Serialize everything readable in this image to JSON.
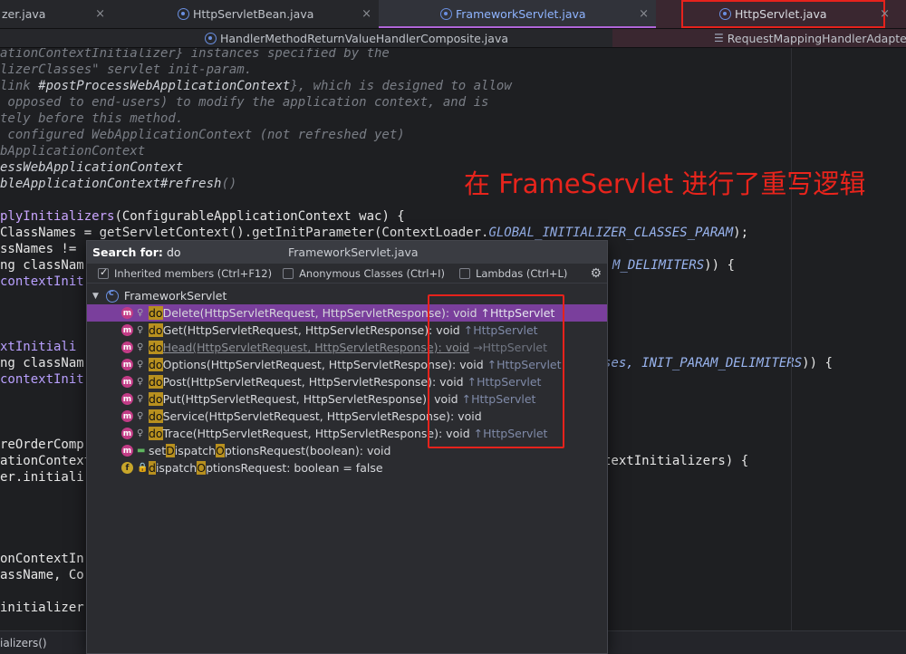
{
  "tabs_row1": [
    {
      "label": "zer.java",
      "close": "×"
    },
    {
      "label": "HttpServletBean.java",
      "close": "×"
    },
    {
      "label": "FrameworkServlet.java",
      "close": "×"
    },
    {
      "label": "HttpServlet.java",
      "close": "×"
    }
  ],
  "tabs_row2": [
    {
      "label": "HandlerMethodReturnValueHandlerComposite.java"
    },
    {
      "label": "RequestMappingHandlerAdapte"
    }
  ],
  "code": {
    "l1": "ationContextInitializer} instances specified by the",
    "l2": "lizerClasses\" servlet init-param.",
    "l3a": "link ",
    "l3b": "#postProcessWebApplicationContext",
    "l3c": "}, which is designed to allow",
    "l4": " opposed to end-users) to modify the application context, and is",
    "l5": "tely before this method.",
    "l6": " configured WebApplicationContext (not refreshed yet)",
    "l7": "bApplicationContext",
    "l8": "essWebApplicationContext",
    "l9a": "bleApplicationContext",
    "l9b": "#refresh",
    "l9c": "()",
    "l10a": "plyInitializers",
    "l10b": "(ConfigurableApplicationContext wac) {",
    "l11a": "ClassNames = getServletContext().getInitParameter(ContextLoader.",
    "l11b": "GLOBAL_INITIALIZER_CLASSES_PARAM",
    "l11c": ");",
    "l12": "ssNames !=",
    "l13a": "ng classNam",
    "l13b": "M_DELIMITERS",
    "l13c": ")) {",
    "l14": "contextInit",
    "l15": "xtInitiali",
    "l16a": "ng classNam",
    "l16b": "ses, ",
    "l16c": "INIT_PARAM_DELIMITERS",
    "l16d": ")) {",
    "l17": "contextInit",
    "l18": "reOrderComp",
    "l19a": "ationContextIn",
    "l19b": "textInitializers) {",
    "l20": "er.initiali",
    "l21": "onContextIn",
    "l22": "assName, Co",
    "l23": "initializer",
    "status": "ializers()"
  },
  "annotation": "在 FrameServlet 进行了重写逻辑",
  "popup": {
    "search_label": "Search for:",
    "search_value": "do",
    "title": "FrameworkServlet.java",
    "options": [
      {
        "label": "Inherited members (Ctrl+F12)",
        "checked": true
      },
      {
        "label": "Anonymous Classes (Ctrl+I)",
        "checked": false
      },
      {
        "label": "Lambdas (Ctrl+L)",
        "checked": false
      }
    ],
    "gear_icon": "gear-icon",
    "root": "FrameworkServlet",
    "items": [
      {
        "icon": "m",
        "match": "do",
        "rest": "Delete(HttpServletRequest, HttpServletResponse): void",
        "inherited": "↑HttpServlet",
        "selected": true
      },
      {
        "icon": "m",
        "match": "do",
        "rest": "Get(HttpServletRequest, HttpServletResponse): void",
        "inherited": "↑HttpServlet"
      },
      {
        "icon": "m",
        "match": "do",
        "rest": "Head(HttpServletRequest, HttpServletResponse): void",
        "inherited": "→HttpServlet",
        "dim": true
      },
      {
        "icon": "m",
        "match": "do",
        "rest": "Options(HttpServletRequest, HttpServletResponse): void",
        "inherited": "↑HttpServlet"
      },
      {
        "icon": "m",
        "match": "do",
        "rest": "Post(HttpServletRequest, HttpServletResponse): void",
        "inherited": "↑HttpServlet"
      },
      {
        "icon": "m",
        "match": "do",
        "rest": "Put(HttpServletRequest, HttpServletResponse): void",
        "inherited": "↑HttpServlet"
      },
      {
        "icon": "m",
        "match": "do",
        "rest": "Service(HttpServletRequest, HttpServletResponse): void",
        "inherited": ""
      },
      {
        "icon": "m",
        "match": "do",
        "rest": "Trace(HttpServletRequest, HttpServletResponse): void",
        "inherited": "↑HttpServlet"
      },
      {
        "icon": "m",
        "pre": "set",
        "match1": "D",
        "mid": "ispatch",
        "match2": "O",
        "post": "ptionsRequest(boolean): void",
        "public": true
      },
      {
        "icon": "f",
        "match1": "d",
        "mid": "ispatch",
        "match2": "O",
        "post": "ptionsRequest: boolean = false",
        "private": true
      }
    ]
  }
}
